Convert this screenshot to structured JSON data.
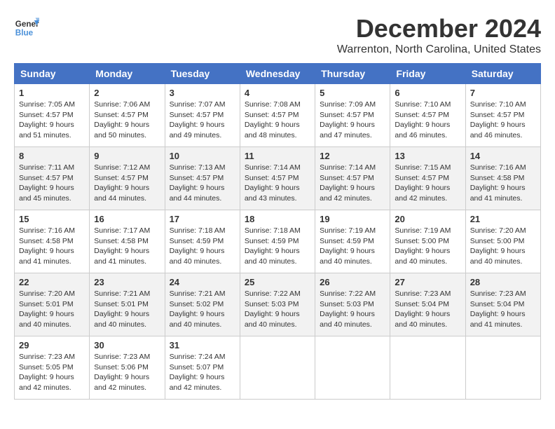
{
  "header": {
    "logo_general": "General",
    "logo_blue": "Blue",
    "month_year": "December 2024",
    "location": "Warrenton, North Carolina, United States"
  },
  "days_of_week": [
    "Sunday",
    "Monday",
    "Tuesday",
    "Wednesday",
    "Thursday",
    "Friday",
    "Saturday"
  ],
  "weeks": [
    [
      {
        "day": "1",
        "sunrise": "7:05 AM",
        "sunset": "4:57 PM",
        "daylight": "9 hours and 51 minutes."
      },
      {
        "day": "2",
        "sunrise": "7:06 AM",
        "sunset": "4:57 PM",
        "daylight": "9 hours and 50 minutes."
      },
      {
        "day": "3",
        "sunrise": "7:07 AM",
        "sunset": "4:57 PM",
        "daylight": "9 hours and 49 minutes."
      },
      {
        "day": "4",
        "sunrise": "7:08 AM",
        "sunset": "4:57 PM",
        "daylight": "9 hours and 48 minutes."
      },
      {
        "day": "5",
        "sunrise": "7:09 AM",
        "sunset": "4:57 PM",
        "daylight": "9 hours and 47 minutes."
      },
      {
        "day": "6",
        "sunrise": "7:10 AM",
        "sunset": "4:57 PM",
        "daylight": "9 hours and 46 minutes."
      },
      {
        "day": "7",
        "sunrise": "7:10 AM",
        "sunset": "4:57 PM",
        "daylight": "9 hours and 46 minutes."
      }
    ],
    [
      {
        "day": "8",
        "sunrise": "7:11 AM",
        "sunset": "4:57 PM",
        "daylight": "9 hours and 45 minutes."
      },
      {
        "day": "9",
        "sunrise": "7:12 AM",
        "sunset": "4:57 PM",
        "daylight": "9 hours and 44 minutes."
      },
      {
        "day": "10",
        "sunrise": "7:13 AM",
        "sunset": "4:57 PM",
        "daylight": "9 hours and 44 minutes."
      },
      {
        "day": "11",
        "sunrise": "7:14 AM",
        "sunset": "4:57 PM",
        "daylight": "9 hours and 43 minutes."
      },
      {
        "day": "12",
        "sunrise": "7:14 AM",
        "sunset": "4:57 PM",
        "daylight": "9 hours and 42 minutes."
      },
      {
        "day": "13",
        "sunrise": "7:15 AM",
        "sunset": "4:57 PM",
        "daylight": "9 hours and 42 minutes."
      },
      {
        "day": "14",
        "sunrise": "7:16 AM",
        "sunset": "4:58 PM",
        "daylight": "9 hours and 41 minutes."
      }
    ],
    [
      {
        "day": "15",
        "sunrise": "7:16 AM",
        "sunset": "4:58 PM",
        "daylight": "9 hours and 41 minutes."
      },
      {
        "day": "16",
        "sunrise": "7:17 AM",
        "sunset": "4:58 PM",
        "daylight": "9 hours and 41 minutes."
      },
      {
        "day": "17",
        "sunrise": "7:18 AM",
        "sunset": "4:59 PM",
        "daylight": "9 hours and 40 minutes."
      },
      {
        "day": "18",
        "sunrise": "7:18 AM",
        "sunset": "4:59 PM",
        "daylight": "9 hours and 40 minutes."
      },
      {
        "day": "19",
        "sunrise": "7:19 AM",
        "sunset": "4:59 PM",
        "daylight": "9 hours and 40 minutes."
      },
      {
        "day": "20",
        "sunrise": "7:19 AM",
        "sunset": "5:00 PM",
        "daylight": "9 hours and 40 minutes."
      },
      {
        "day": "21",
        "sunrise": "7:20 AM",
        "sunset": "5:00 PM",
        "daylight": "9 hours and 40 minutes."
      }
    ],
    [
      {
        "day": "22",
        "sunrise": "7:20 AM",
        "sunset": "5:01 PM",
        "daylight": "9 hours and 40 minutes."
      },
      {
        "day": "23",
        "sunrise": "7:21 AM",
        "sunset": "5:01 PM",
        "daylight": "9 hours and 40 minutes."
      },
      {
        "day": "24",
        "sunrise": "7:21 AM",
        "sunset": "5:02 PM",
        "daylight": "9 hours and 40 minutes."
      },
      {
        "day": "25",
        "sunrise": "7:22 AM",
        "sunset": "5:03 PM",
        "daylight": "9 hours and 40 minutes."
      },
      {
        "day": "26",
        "sunrise": "7:22 AM",
        "sunset": "5:03 PM",
        "daylight": "9 hours and 40 minutes."
      },
      {
        "day": "27",
        "sunrise": "7:23 AM",
        "sunset": "5:04 PM",
        "daylight": "9 hours and 40 minutes."
      },
      {
        "day": "28",
        "sunrise": "7:23 AM",
        "sunset": "5:04 PM",
        "daylight": "9 hours and 41 minutes."
      }
    ],
    [
      {
        "day": "29",
        "sunrise": "7:23 AM",
        "sunset": "5:05 PM",
        "daylight": "9 hours and 42 minutes."
      },
      {
        "day": "30",
        "sunrise": "7:23 AM",
        "sunset": "5:06 PM",
        "daylight": "9 hours and 42 minutes."
      },
      {
        "day": "31",
        "sunrise": "7:24 AM",
        "sunset": "5:07 PM",
        "daylight": "9 hours and 42 minutes."
      },
      null,
      null,
      null,
      null
    ]
  ]
}
